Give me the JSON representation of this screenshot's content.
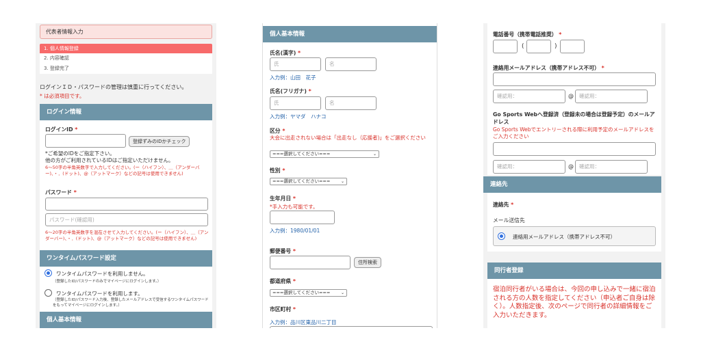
{
  "p1": {
    "rep_header": "代表者情報入力",
    "steps": [
      "1. 個人情報登録",
      "2. 内容確認",
      "3. 登録完了"
    ],
    "notice": "ログインＩＤ・パスワードの管理は慎重に行ってください。",
    "required_note": "は必須項目です。",
    "login_section": "ログイン情報",
    "login_id_label": "ログインID",
    "check_button": "登録ずみのIDかチェック",
    "login_hint1": "*ご希望のIDをご指定下さい。",
    "login_hint2": "他の方がご利用されているIDはご指定いただけません。",
    "login_rule": "6〜50字の半角英数字で入力してください。(ー（ハイフン）、＿（アンダーバー)、・．(ドット)、@（アットマーク）などの記号は使用できません)",
    "password_label": "パスワード",
    "password_confirm_placeholder": "パスワード(確認用)",
    "password_rule": "6〜20字の半角英数字を混在させて入力してください。(ー（ハイフン）、＿（アンダーバー)、・．(ドット)、@（アットマーク）などの記号は使用できません)",
    "otp_section": "ワンタイムパスワード設定",
    "otp_off": "ワンタイムパスワードを利用しません。",
    "otp_off_sub": "（登録したID/パスワードのみでマイページにログインします。）",
    "otp_on": "ワンタイムパスワードを利用します。",
    "otp_on_sub": "（登録したID/パスワード入力後、登録したメールアドレスで受信するワンタイムパスワードをもってマイページにログインします。）",
    "personal_section": "個人基本情報"
  },
  "p2": {
    "section": "個人基本情報",
    "name_kanji_label": "氏名(漢字)",
    "sei": "氏",
    "mei": "名",
    "name_kanji_example": "入力例：山田　花子",
    "name_kana_label": "氏名(フリガナ)",
    "name_kana_example": "入力例：ヤマダ　ハナコ",
    "category_label": "区分",
    "category_note": "大会に出走されない場合は「出走なし（応援者)」をご選択ください",
    "select_placeholder": "===選択してください===",
    "gender_label": "性別",
    "birthday_label": "生年月日",
    "birthday_note": "*手入力も可能です。",
    "birthday_example": "入力例：1980/01/01",
    "postal_label": "郵便番号",
    "address_search_button": "住所検索",
    "prefecture_label": "都道府県",
    "city_label": "市区町村",
    "city_example": "入力例：品川区東品川二丁目"
  },
  "p3": {
    "phone_label": "電話番号（携帯電話推奨）",
    "paren_open": "(",
    "paren_close": ")",
    "email_label": "連絡用メールアドレス（携帯アドレス不可）",
    "confirm_placeholder": "確認用：",
    "at": "@",
    "gosports_label": "Go Sports Webへ登録済（登録未の場合は登録予定）のメールアドレス",
    "gosports_note": "Go Sports Webでエントリーされる際に利用予定のメールアドレスをご入力ください",
    "contact_section": "連絡先",
    "contact_label": "連絡先",
    "mail_dest_label": "メール送信先",
    "mail_dest_option": "連絡用メールアドレス（携帯アドレス不可）",
    "companion_section": "同行者登録",
    "companion_text": "宿泊同行者がいる場合は、今回の申し込みで一緒に宿泊される方の人数を指定してください（申込者ご自身は除く）。人数指定後、次のページで同行者の詳細情報をご入力いただきます。"
  },
  "colors": {
    "section_bg": "#6e95a8",
    "required": "#d9322b",
    "example": "#1f5fa8",
    "step_active": "#f76a6a"
  },
  "icons": [
    "chevron-down-icon",
    "radio-icon"
  ]
}
